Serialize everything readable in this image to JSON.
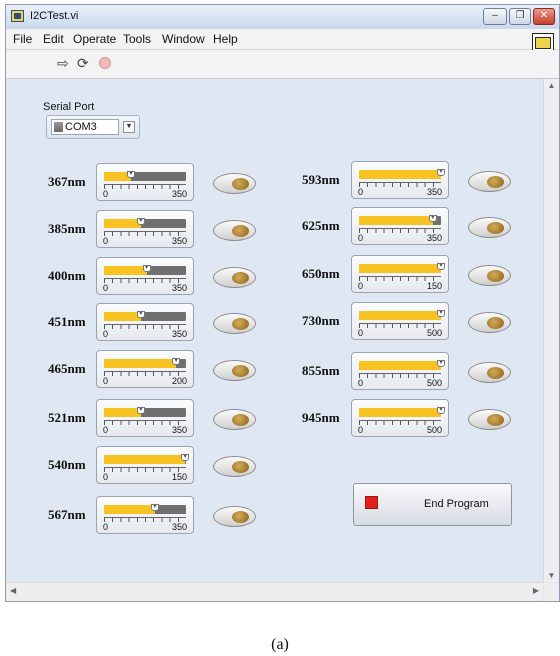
{
  "window": {
    "title": "I2CTest.vi",
    "minimize_glyph": "–",
    "restore_glyph": "❐",
    "close_glyph": "✕"
  },
  "menu": [
    "File",
    "Edit",
    "Operate",
    "Tools",
    "Window",
    "Help"
  ],
  "toolbar": {
    "run_icon": "run-arrow-icon",
    "run_continuous_icon": "run-continuously-icon",
    "abort_icon": "abort-icon"
  },
  "vi_icon_number": "1",
  "serial_port": {
    "label": "Serial Port",
    "value": "COM3"
  },
  "channels": [
    {
      "name": "367nm",
      "max": "350",
      "min": "0",
      "level": 0.33
    },
    {
      "name": "385nm",
      "max": "350",
      "min": "0",
      "level": 0.45
    },
    {
      "name": "400nm",
      "max": "350",
      "min": "0",
      "level": 0.52
    },
    {
      "name": "451nm",
      "max": "350",
      "min": "0",
      "level": 0.45
    },
    {
      "name": "465nm",
      "max": "200",
      "min": "0",
      "level": 0.88
    },
    {
      "name": "521nm",
      "max": "350",
      "min": "0",
      "level": 0.45
    },
    {
      "name": "540nm",
      "max": "150",
      "min": "0",
      "level": 0.99
    },
    {
      "name": "567nm",
      "max": "350",
      "min": "0",
      "level": 0.62
    },
    {
      "name": "593nm",
      "max": "350",
      "min": "0",
      "level": 1.0
    },
    {
      "name": "625nm",
      "max": "350",
      "min": "0",
      "level": 0.9
    },
    {
      "name": "650nm",
      "max": "150",
      "min": "0",
      "level": 1.0
    },
    {
      "name": "730nm",
      "max": "500",
      "min": "0",
      "level": 1.0
    },
    {
      "name": "855nm",
      "max": "500",
      "min": "0",
      "level": 1.0
    },
    {
      "name": "945nm",
      "max": "500",
      "min": "0",
      "level": 1.0
    }
  ],
  "end_button": {
    "label": "End Program"
  },
  "caption": "(a)",
  "colors": {
    "fill": "#f7c222",
    "track": "#6f6f6f",
    "panel": "#dfe7f2",
    "stop": "#e3201b"
  }
}
